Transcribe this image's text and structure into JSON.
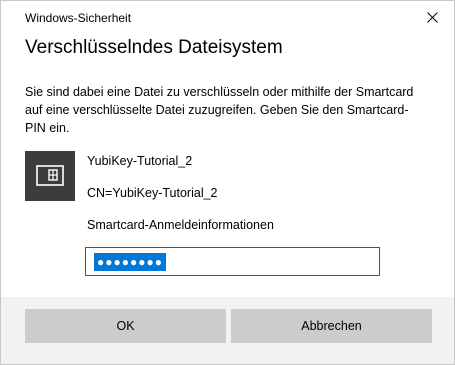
{
  "window": {
    "title": "Windows-Sicherheit",
    "close_icon": "close-icon"
  },
  "dialog": {
    "heading": "Verschlüsselndes Dateisystem",
    "description": "Sie sind dabei eine Datei zu verschlüsseln oder mithilfe der Smartcard auf eine verschlüsselte Datei zuzugreifen. Geben Sie den Smartcard-PIN ein."
  },
  "credential": {
    "icon": "smartcard-icon",
    "name": "YubiKey-Tutorial_2",
    "cn": "CN=YubiKey-Tutorial_2",
    "subtitle": "Smartcard-Anmeldeinformationen"
  },
  "pin": {
    "masked_value": "●●●●●●●●",
    "selected": true
  },
  "buttons": {
    "ok_label": "OK",
    "cancel_label": "Abbrechen"
  },
  "colors": {
    "accent": "#0078d7",
    "field_border": "#0067c0",
    "button_bg": "#cccccc",
    "footer_bg": "#f2f2f2",
    "icon_bg": "#3c3c3c"
  }
}
